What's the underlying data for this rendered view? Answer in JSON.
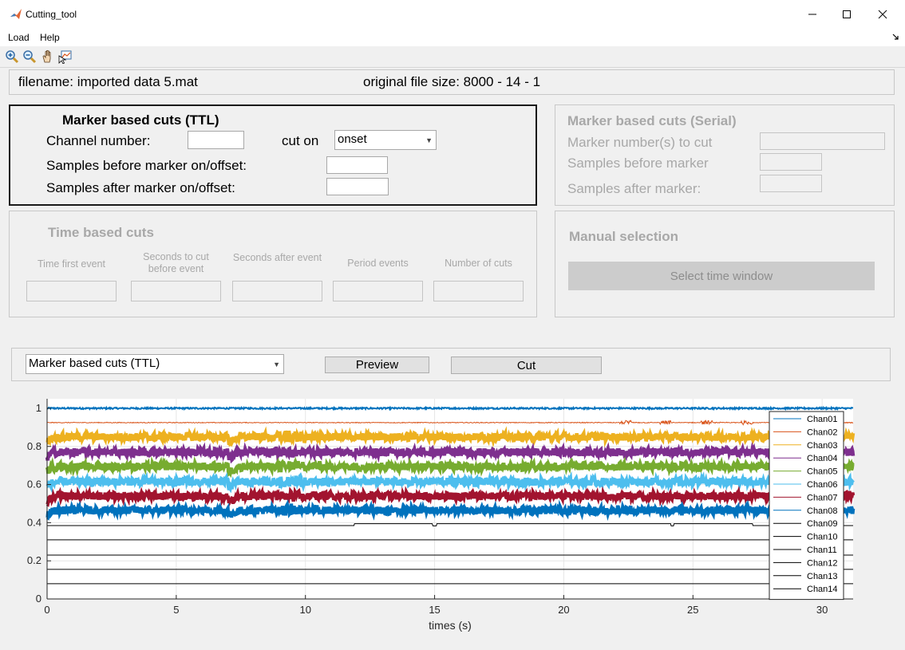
{
  "window": {
    "title": "Cutting_tool"
  },
  "menu": {
    "items": [
      "Load",
      "Help"
    ]
  },
  "toolbar": {
    "icons": [
      "zoom-in-icon",
      "zoom-out-icon",
      "pan-hand-icon",
      "data-cursor-icon"
    ]
  },
  "info": {
    "filename": "filename: imported  data  5.mat",
    "filesize": "original file size: 8000 - 14 - 1"
  },
  "ttl_panel": {
    "title": "Marker based cuts (TTL)",
    "channel_label": "Channel number:",
    "channel_value": "",
    "cut_on_label": "cut on",
    "cut_on_value": "onset",
    "before_label": "Samples before marker on/offset:",
    "before_value": "",
    "after_label": "Samples after marker on/offset:",
    "after_value": ""
  },
  "serial_panel": {
    "title": "Marker based cuts (Serial)",
    "marker_label": "Marker number(s) to cut",
    "before_label": "Samples before marker",
    "after_label": "Samples after marker:"
  },
  "time_panel": {
    "title": "Time based cuts",
    "fields": [
      {
        "label": "Time first event"
      },
      {
        "label": "Seconds to cut before event"
      },
      {
        "label": "Seconds after event"
      },
      {
        "label": "Period events"
      },
      {
        "label": "Number of cuts"
      }
    ]
  },
  "manual_panel": {
    "title": "Manual selection",
    "button": "Select time window"
  },
  "controls": {
    "method_value": "Marker based cuts (TTL)",
    "preview_button": "Preview",
    "cut_button": "Cut"
  },
  "chart_data": {
    "type": "line",
    "xlabel": "times (s)",
    "ylabel": "",
    "xlim": [
      0,
      31.2
    ],
    "ylim": [
      0,
      1.05
    ],
    "xticks": [
      0,
      5,
      10,
      15,
      20,
      25,
      30
    ],
    "yticks": [
      0,
      0.2,
      0.4,
      0.6,
      0.8,
      1
    ],
    "ytick_labels": [
      "0",
      "0.2",
      "0.4",
      "0.6",
      "0.8",
      "1"
    ],
    "grid": true,
    "legend_position": "right",
    "series": [
      {
        "name": "Chan01",
        "color": "#0072bd",
        "baseline": 1.0,
        "noise": 0.004,
        "width": 2.0
      },
      {
        "name": "Chan02",
        "color": "#d95319",
        "baseline": 0.925,
        "noise": 0.002,
        "width": 1.0
      },
      {
        "name": "Chan03",
        "color": "#edb120",
        "baseline": 0.85,
        "noise": 0.02,
        "width": 4.5
      },
      {
        "name": "Chan04",
        "color": "#7e2f8e",
        "baseline": 0.77,
        "noise": 0.02,
        "width": 4.5
      },
      {
        "name": "Chan05",
        "color": "#77ac30",
        "baseline": 0.695,
        "noise": 0.02,
        "width": 4.5
      },
      {
        "name": "Chan06",
        "color": "#4dbeee",
        "baseline": 0.615,
        "noise": 0.02,
        "width": 4.5
      },
      {
        "name": "Chan07",
        "color": "#a2142f",
        "baseline": 0.54,
        "noise": 0.02,
        "width": 4.5
      },
      {
        "name": "Chan08",
        "color": "#0072bd",
        "baseline": 0.465,
        "noise": 0.02,
        "width": 4.5
      },
      {
        "name": "Chan09",
        "color": "#000000",
        "baseline": 0.385,
        "noise": 0,
        "width": 1.0
      },
      {
        "name": "Chan10",
        "color": "#000000",
        "baseline": 0.31,
        "noise": 0,
        "width": 1.0
      },
      {
        "name": "Chan11",
        "color": "#000000",
        "baseline": 0.23,
        "noise": 0,
        "width": 1.0
      },
      {
        "name": "Chan12",
        "color": "#000000",
        "baseline": 0.155,
        "noise": 0,
        "width": 1.0
      },
      {
        "name": "Chan13",
        "color": "#000000",
        "baseline": 0.08,
        "noise": 0,
        "width": 1.0
      },
      {
        "name": "Chan14",
        "color": "#000000",
        "baseline": 0.0,
        "noise": 0,
        "width": 1.0
      }
    ]
  }
}
